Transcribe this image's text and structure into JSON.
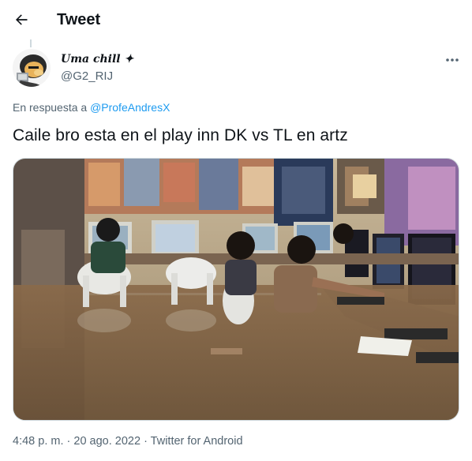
{
  "header": {
    "title": "Tweet",
    "back_icon": "arrow-left-icon"
  },
  "author": {
    "display_name": "Uma chill",
    "name_emoji": "✦",
    "handle": "@G2_RIJ",
    "avatar": "cartoon-avatar"
  },
  "reply": {
    "prefix": "En respuesta a",
    "mention": "@ProfeAndresX"
  },
  "tweet": {
    "text": "Caile bro esta en el play inn DK vs TL en artz",
    "media": "photo-flooded-internet-cafe"
  },
  "meta": {
    "time": "4:48 p. m.",
    "separator1": " · ",
    "date": "20 ago. 2022",
    "separator2": " · ",
    "source": "Twitter for Android"
  },
  "colors": {
    "link": "#1d9bf0",
    "secondary": "#536471",
    "primary": "#0f1419"
  }
}
